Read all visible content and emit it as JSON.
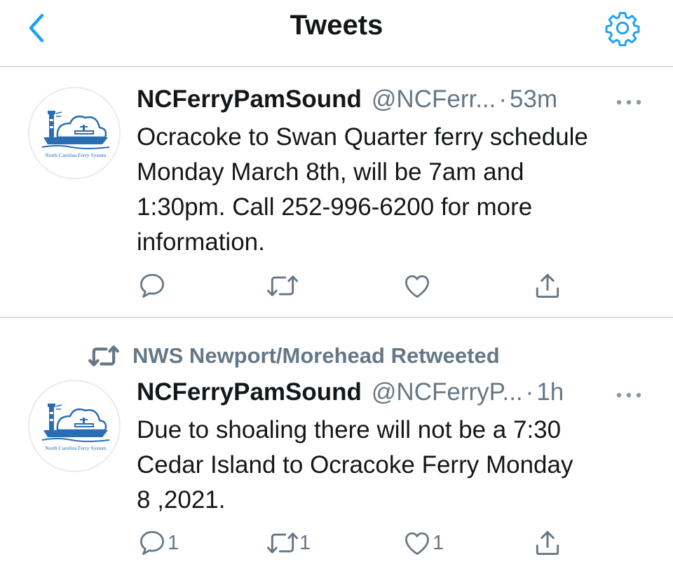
{
  "header": {
    "title": "Tweets",
    "back_icon": "chevron-left-icon",
    "settings_icon": "gear-icon",
    "accent_color": "#1da1f2"
  },
  "tweets": [
    {
      "name": "NCFerryPamSound",
      "handle": "@NCFerr...",
      "separator": "·",
      "time": "53m",
      "text": "Ocracoke to Swan Quarter ferry schedule\nMonday March 8th, will be 7am and\n1:30pm. Call 252-996-6200 for more\ninformation.",
      "avatar_text": "North Carolina Ferry System",
      "counts": {
        "reply": "",
        "retweet": "",
        "like": ""
      }
    },
    {
      "retweeted_by": "NWS Newport/Morehead Retweeted",
      "name": "NCFerryPamSound",
      "handle": "@NCFerryP...",
      "separator": "·",
      "time": "1h",
      "text": "Due to shoaling there will not be a 7:30\nCedar Island to Ocracoke Ferry Monday\n8 ,2021.",
      "avatar_text": "North Carolina Ferry System",
      "counts": {
        "reply": "1",
        "retweet": "1",
        "like": "1"
      }
    }
  ]
}
